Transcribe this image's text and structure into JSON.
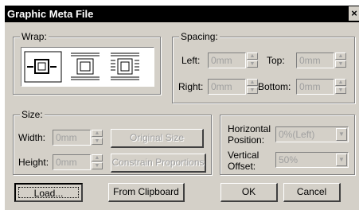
{
  "window": {
    "title": "Graphic Meta File",
    "close_glyph": "×"
  },
  "wrap": {
    "legend": "Wrap:",
    "options": [
      {
        "name": "no-wrap-icon"
      },
      {
        "name": "top-bottom-wrap-icon"
      },
      {
        "name": "around-wrap-icon"
      }
    ]
  },
  "spacing": {
    "legend": "Spacing:",
    "left_label": "Left:",
    "left_value": "0mm",
    "top_label": "Top:",
    "top_value": "0mm",
    "right_label": "Right:",
    "right_value": "0mm",
    "bottom_label": "Bottom:",
    "bottom_value": "0mm"
  },
  "size": {
    "legend": "Size:",
    "width_label": "Width:",
    "width_value": "0mm",
    "height_label": "Height:",
    "height_value": "0mm",
    "original_size_label": "Original Size",
    "constrain_label": "Constrain Proportions"
  },
  "position": {
    "horizontal_label_1": "Horizontal",
    "horizontal_label_2": "Position:",
    "horizontal_value": "0%(Left)",
    "vertical_label_1": "Vertical",
    "vertical_label_2": "Offset:",
    "vertical_value": "50%"
  },
  "buttons": {
    "load": "Load...",
    "from_clipboard": "From Clipboard",
    "ok": "OK",
    "cancel": "Cancel"
  }
}
